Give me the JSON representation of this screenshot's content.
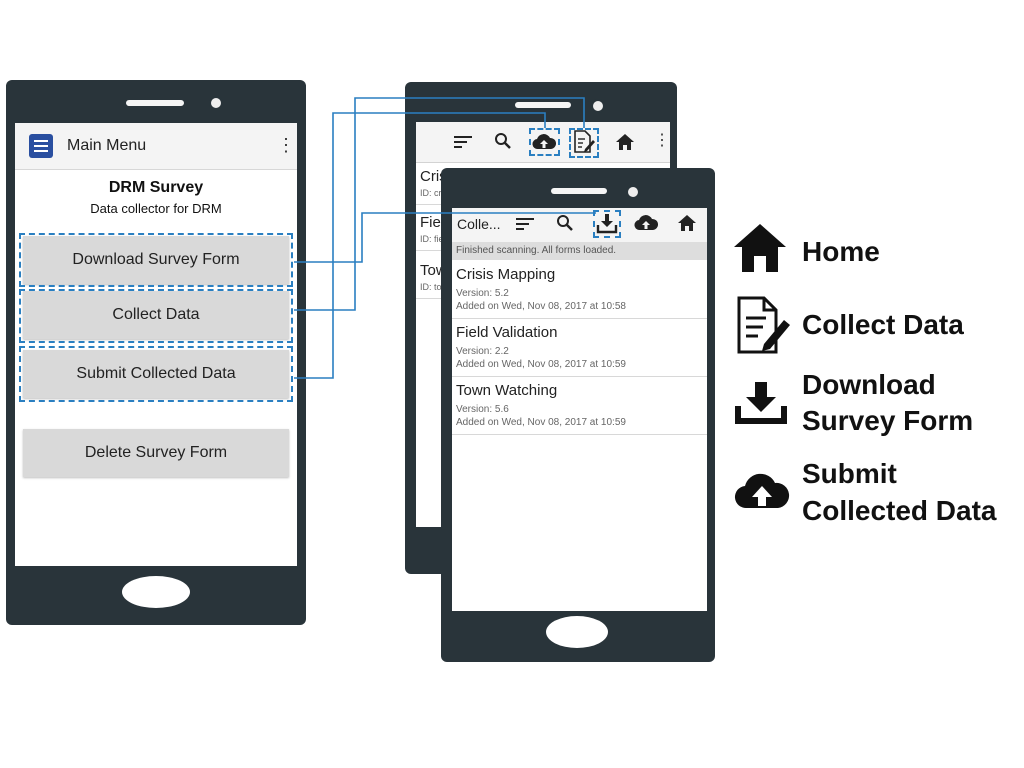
{
  "phone_main": {
    "appbar_title": "Main Menu",
    "app_name": "DRM Survey",
    "app_subtitle": "Data collector for DRM",
    "buttons": [
      {
        "label": "Download Survey Form",
        "highlighted": true
      },
      {
        "label": "Collect Data",
        "highlighted": true
      },
      {
        "label": "Submit Collected Data",
        "highlighted": true
      },
      {
        "label": "Delete Survey Form",
        "highlighted": false
      }
    ]
  },
  "phone_back": {
    "toolbar_icons": [
      "sort-icon",
      "search-icon",
      "cloud-upload-icon",
      "edit-form-icon",
      "home-icon",
      "overflow-menu-icon"
    ],
    "list_stubs": [
      {
        "title": "Cris",
        "id": "ID: cr"
      },
      {
        "title": "Fie",
        "id": "ID: fie"
      },
      {
        "title": "Tow",
        "id": "ID: to"
      }
    ]
  },
  "phone_front": {
    "toolbar_title": "Colle...",
    "toolbar_icons": [
      "sort-icon",
      "search-icon",
      "download-icon",
      "cloud-upload-icon",
      "home-icon"
    ],
    "status": "Finished scanning. All forms loaded.",
    "forms": [
      {
        "title": "Crisis Mapping",
        "version": "Version: 5.2",
        "added": "Added on Wed, Nov 08, 2017 at 10:58"
      },
      {
        "title": "Field Validation",
        "version": "Version: 2.2",
        "added": "Added on Wed, Nov 08, 2017 at 10:59"
      },
      {
        "title": "Town Watching",
        "version": "Version: 5.6",
        "added": "Added on Wed, Nov 08, 2017 at 10:59"
      }
    ]
  },
  "legend": {
    "items": [
      {
        "icon": "home-icon",
        "line1": "Home",
        "line2": ""
      },
      {
        "icon": "collect-data-icon",
        "line1": "Collect Data",
        "line2": ""
      },
      {
        "icon": "download-icon",
        "line1": "Download",
        "line2": "Survey Form"
      },
      {
        "icon": "cloud-upload-icon",
        "line1": "Submit",
        "line2": "Collected Data"
      }
    ]
  },
  "colors": {
    "phone_body": "#29343a",
    "highlight_dash": "#2a7fc1",
    "connector_line": "#2a7fc1",
    "button_fill": "#d9d9d9",
    "app_icon": "#2a4fa0"
  }
}
